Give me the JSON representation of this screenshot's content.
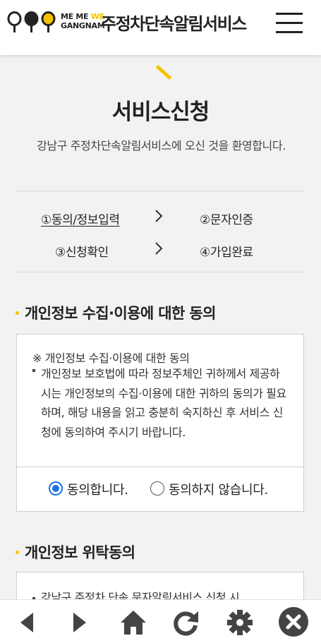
{
  "header": {
    "logo_line1_part1": "ME ME ",
    "logo_line1_part2": "WE",
    "logo_line2": "GANGNAM",
    "title": "주정차단속알림서비스",
    "menu_icon": "hamburger-menu-icon"
  },
  "page": {
    "title": "서비스신청",
    "welcome": "강남구 주정차단속알림서비스에 오신 것을 환영합니다."
  },
  "steps": {
    "step1": "①동의/정보입력",
    "step2": "②문자인증",
    "step3": "③신청확인",
    "step4": "④가입완료"
  },
  "section1": {
    "title": "개인정보 수집·이용에 대한 동의",
    "note": "※ 개인정보 수집·이용에 대한 동의",
    "body": "개인정보 보호법에 따라 정보주체인 귀하께서 제공하시는 개인정보의 수집·이용에 대한 귀하의 동의가 필요하며, 해당 내용을 읽고 충분히 숙지하신 후 서비스 신청에 동의하여 주시기 바랍니다.",
    "agree_label": "동의합니다.",
    "disagree_label": "동의하지 않습니다.",
    "selected": "agree"
  },
  "section2": {
    "title": "개인정보 위탁동의",
    "body_partial": "강남구 주정차 단속 문자알림서비스 신청 시"
  },
  "bottom_nav": [
    "back-icon",
    "forward-icon",
    "home-icon",
    "refresh-icon",
    "settings-icon",
    "close-icon"
  ],
  "colors": {
    "accent_yellow": "#f4c300",
    "radio_blue": "#1a73e8",
    "background": "#f2f2f2"
  }
}
